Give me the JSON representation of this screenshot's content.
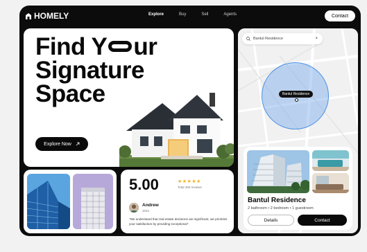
{
  "nav": {
    "logo": "HOMELY",
    "links": [
      "Explore",
      "Buy",
      "Sell",
      "Agents"
    ],
    "contact_label": "Contact"
  },
  "hero": {
    "title_line1_prefix": "Find Y",
    "title_line1_suffix": "ur",
    "title_line2": "Signature",
    "title_line3": "Space",
    "cta_label": "Explore Now",
    "cta_icon": "arrow-up-right-icon"
  },
  "map": {
    "search_value": "Bantul Residence",
    "search_icon": "search-icon",
    "clear_icon": "close-icon",
    "pin_label": "Bantul Residence"
  },
  "property": {
    "title": "Bantul Residence",
    "specs": "2 bathroom • 2 bedroom • 1 guestroom",
    "details_label": "Details",
    "contact_label": "Contact"
  },
  "review": {
    "rating": "5.00",
    "stars": "★★★★★",
    "total": "Total 460 reviews",
    "name": "Andrew",
    "year": "2022",
    "quote": "\"We understand that real estate decisions are significant, we prioritize your satisfaction by providing exceptional\"."
  },
  "colors": {
    "frame": "#0c0c0c",
    "accent_blue": "#4a90e2",
    "star": "#f2b01e"
  }
}
